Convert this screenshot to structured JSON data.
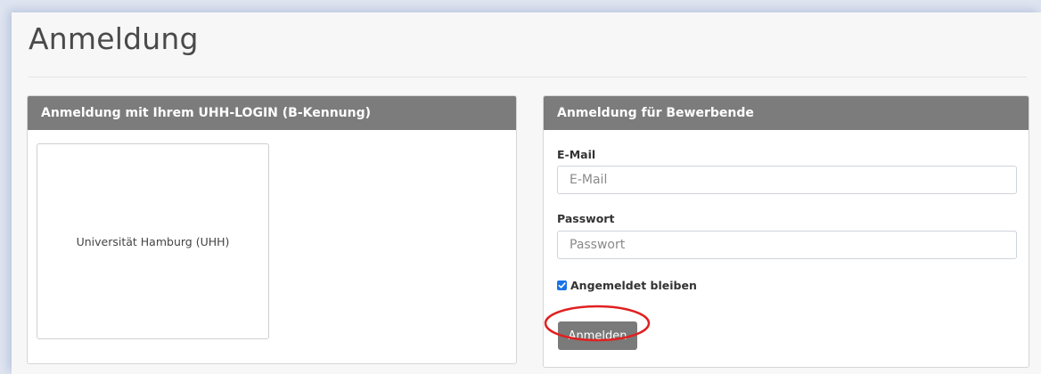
{
  "page": {
    "title": "Anmeldung"
  },
  "uhh_login": {
    "header": "Anmeldung mit Ihrem UHH-LOGIN (B-Kennung)",
    "provider_label": "Universität Hamburg (UHH)"
  },
  "applicant_login": {
    "header": "Anmeldung für Bewerbende",
    "email_label": "E-Mail",
    "email_placeholder": "E-Mail",
    "email_value": "",
    "password_label": "Passwort",
    "password_placeholder": "Passwort",
    "password_value": "",
    "remember_label": "Angemeldet bleiben",
    "remember_checked": true,
    "submit_label": "Anmelden"
  },
  "colors": {
    "panel_header": "#7c7c7c",
    "checkbox": "#1a73e8",
    "highlight": "#e02020"
  },
  "icons": {
    "checkbox": "check-icon"
  }
}
